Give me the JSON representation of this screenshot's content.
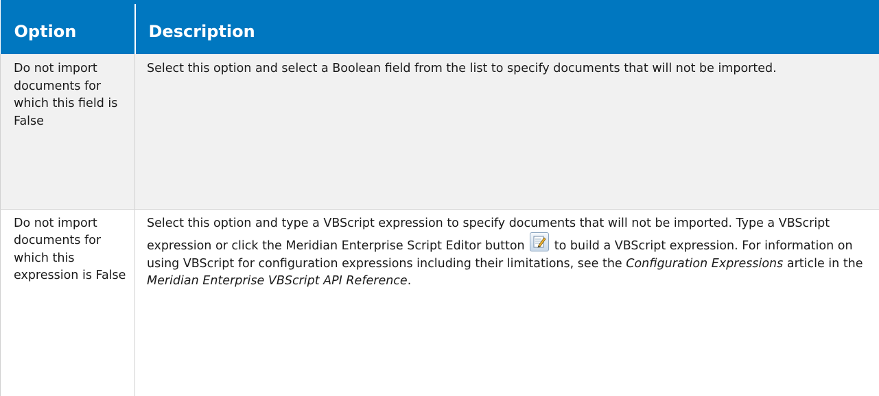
{
  "table": {
    "headers": {
      "option": "Option",
      "description": "Description"
    },
    "rows": [
      {
        "option": "Do not import documents for which this field is False",
        "description": "Select this option and select a Boolean field from the list to specify documents that will not be imported."
      },
      {
        "option": "Do not import documents for which this expression is False",
        "description_part1": "Select this option and type a VBScript expression to specify documents that will not be imported. Type a VBScript expression or click the Meridian Enterprise Script Editor button ",
        "description_part2": " to build a VBScript expression.  For information on using VBScript for configuration expressions including their limitations, see the ",
        "link1": "Configuration Expressions",
        "description_part3": " article in the ",
        "link2": "Meridian Enterprise VBScript API Reference",
        "description_part4": ".",
        "icon": "script-editor-icon"
      }
    ]
  }
}
